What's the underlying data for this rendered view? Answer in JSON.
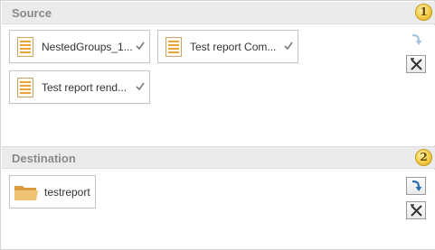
{
  "source": {
    "title": "Source",
    "step": "1",
    "items": [
      {
        "label": "NestedGroups_1...",
        "icon": "report-document-icon",
        "status_icon": "checkmark-icon"
      },
      {
        "label": "Test report Com...",
        "icon": "report-document-icon",
        "status_icon": "checkmark-icon"
      },
      {
        "label": "Test report rend...",
        "icon": "report-document-icon",
        "status_icon": "checkmark-icon"
      }
    ],
    "actions": [
      {
        "name": "move-down-button",
        "icon": "arrow-down-icon",
        "enabled": false
      },
      {
        "name": "clear-button",
        "icon": "clear-x-icon",
        "enabled": true
      }
    ]
  },
  "destination": {
    "title": "Destination",
    "step": "2",
    "items": [
      {
        "label": "testreport",
        "icon": "folder-icon"
      }
    ],
    "actions": [
      {
        "name": "move-down-button",
        "icon": "arrow-down-icon",
        "enabled": true
      },
      {
        "name": "clear-button",
        "icon": "clear-x-icon",
        "enabled": true
      }
    ]
  },
  "colors": {
    "header_bg": "#ebebeb",
    "badge": "#f3cb45",
    "folder": "#e8b25a",
    "arrow_active": "#2f6fb0",
    "arrow_disabled": "#a8c4df"
  }
}
